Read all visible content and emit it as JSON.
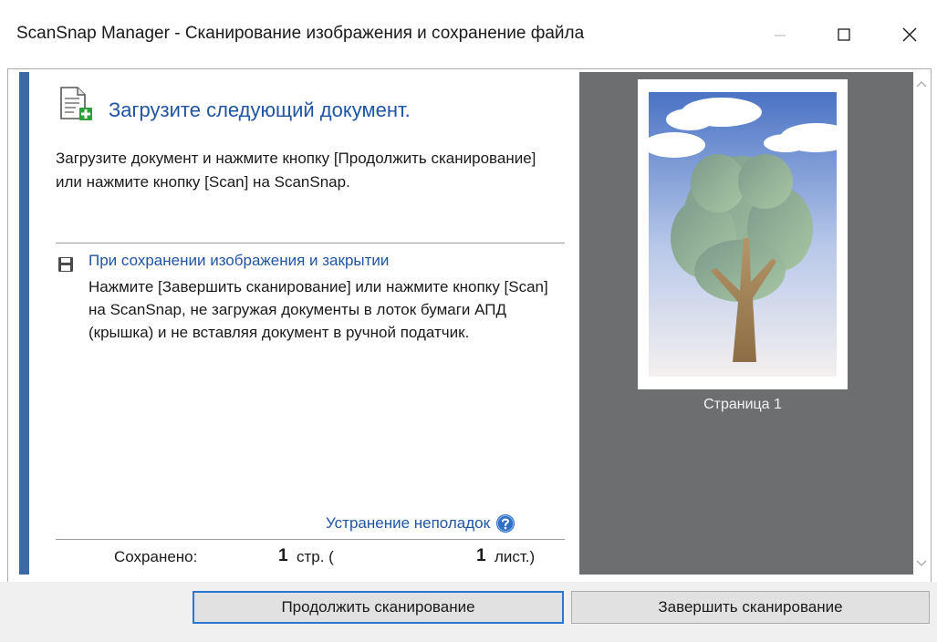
{
  "window": {
    "title": "ScanSnap Manager - Сканирование изображения и сохранение файла",
    "controls": {
      "minimize": "minimize-icon",
      "maximize": "maximize-icon",
      "close": "close-icon"
    }
  },
  "left_panel": {
    "heading": "Загрузите следующий документ.",
    "instruction": "Загрузите документ и нажмите кнопку [Продолжить сканирование] или нажмите кнопку [Scan] на ScanSnap.",
    "save_section": {
      "title": "При сохранении изображения и закрытии",
      "body": "Нажмите [Завершить сканирование] или нажмите кнопку [Scan] на ScanSnap, не загружая документы в лоток бумаги АПД (крышка) и не вставляя документ в ручной податчик."
    },
    "troubleshooting_link": "Устранение неполадок",
    "status": {
      "label": "Сохранено:",
      "pages_count": "1",
      "pages_unit": "стр. (",
      "sheets_count": "1",
      "sheets_unit": "лист.)"
    }
  },
  "preview": {
    "page_label": "Страница 1"
  },
  "buttons": {
    "continue": "Продолжить сканирование",
    "finish": "Завершить сканирование"
  },
  "colors": {
    "accent": "#3d6aa3",
    "link": "#1f55a3",
    "preview_bg": "#6c6e70",
    "focus_border": "#2a76d1"
  }
}
